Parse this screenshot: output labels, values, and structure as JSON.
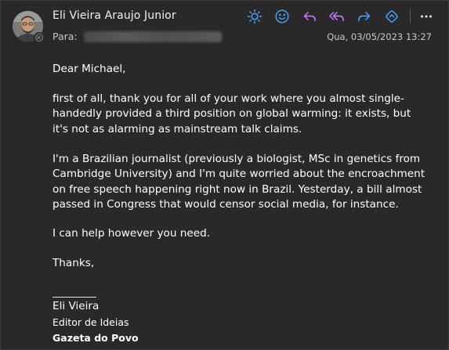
{
  "header": {
    "sender_name": "Eli Vieira Araujo Junior",
    "to_label": "Para:",
    "date": "Qua, 03/05/2023 13:27"
  },
  "toolbar": {
    "icons": [
      "sun-icon",
      "emoji-icon",
      "reply-icon",
      "reply-all-icon",
      "forward-icon",
      "sync-icon",
      "more-icon"
    ],
    "colors": {
      "accent_blue": "#4aa3ff",
      "accent_purple": "#c77dff"
    }
  },
  "message": {
    "greeting": "Dear Michael,",
    "paragraph1": "first of all, thank you for all of your work where you almost single-handedly provided a third position on global warming: it exists, but it's not as alarming as mainstream talk claims.",
    "paragraph2": "I'm a Brazilian journalist (previously a biologist, MSc in genetics from Cambridge University) and I'm quite worried about the encroachment on free speech happening right now in Brazil. Yesterday, a bill almost passed in Congress that would censor social media, for instance.",
    "paragraph3": "I can help however you need.",
    "closing": "Thanks,"
  },
  "signature": {
    "name": "Eli Vieira",
    "title": "Editor de Ideias",
    "company": "Gazeta do Povo"
  }
}
